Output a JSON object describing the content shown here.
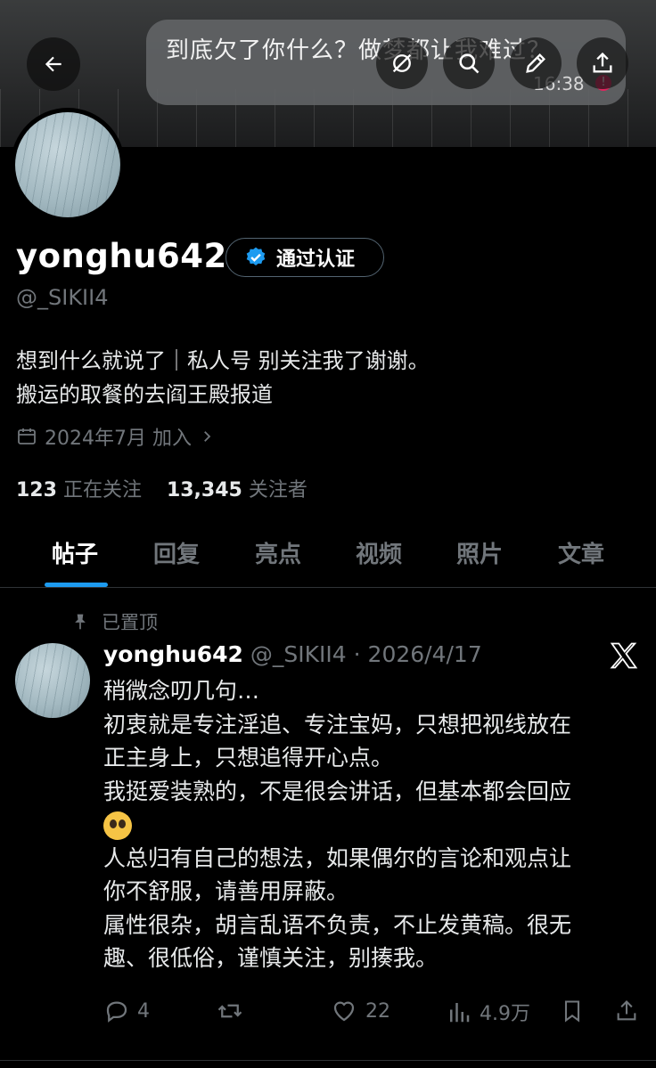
{
  "notification": {
    "text": "到底欠了你什么？做梦都让我难过？",
    "time": "16:38",
    "badge": "!"
  },
  "profile": {
    "display_name": "yonghu642",
    "verified_label": "通过认证",
    "handle": "@_SIKII4",
    "bio_line1": "想到什么就说了｜私人号 别关注我了谢谢。",
    "bio_line2": "搬运的取餐的去阎王殿报道",
    "joined": "2024年7月 加入",
    "following_count": "123",
    "following_label": "正在关注",
    "followers_count": "13,345",
    "followers_label": "关注者"
  },
  "tabs": [
    "帖子",
    "回复",
    "亮点",
    "视频",
    "照片",
    "文章"
  ],
  "pinned_post": {
    "pinned_label": "已置顶",
    "author": "yonghu642",
    "meta": "@_SIKII4 · 2026/4/17",
    "lines": [
      "稍微念叨几句…",
      "初衷就是专注淫追、专注宝妈，只想把视线放在",
      "正主身上，只想追得开心点。",
      "我挺爱装熟的，不是很会讲话，但基本都会回应",
      "",
      "人总归有自己的想法，如果偶尔的言论和观点让",
      "你不舒服，请善用屏蔽。",
      "属性很杂，胡言乱语不负责，不止发黄稿。很无",
      "趣、很低俗，谨慎关注，别揍我。"
    ],
    "replies": "4",
    "likes": "22",
    "views": "4.9万"
  },
  "colors": {
    "accent": "#1d9bf0",
    "muted": "#71767b",
    "bg": "#000000"
  }
}
